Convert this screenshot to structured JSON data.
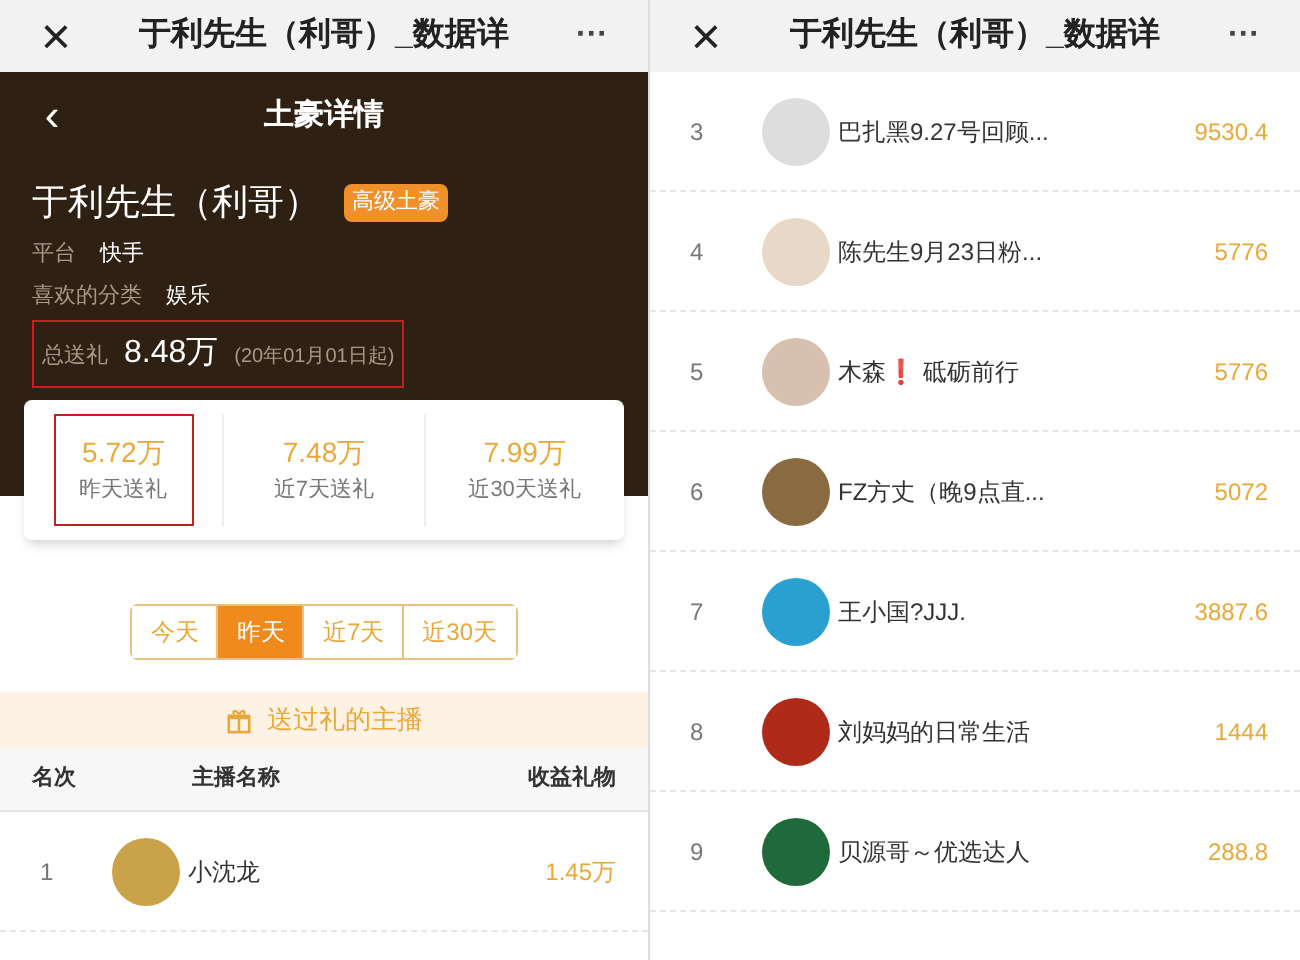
{
  "panels": [
    {
      "top_bar": {
        "close": "×",
        "title": "于利先生（利哥）_数据详",
        "more": "···"
      },
      "hero": {
        "back": "‹",
        "title": "土豪详情",
        "name": "于利先生（利哥）",
        "badge": "高级土豪",
        "fields": [
          {
            "label": "平台",
            "value": "快手"
          },
          {
            "label": "喜欢的分类",
            "value": "娱乐"
          }
        ],
        "total": {
          "label": "总送礼",
          "value": "8.48万",
          "note": "(20年01月01日起)",
          "highlighted": true
        }
      },
      "stats": [
        {
          "value": "5.72万",
          "label": "昨天送礼",
          "highlighted": true
        },
        {
          "value": "7.48万",
          "label": "近7天送礼",
          "highlighted": false
        },
        {
          "value": "7.99万",
          "label": "近30天送礼",
          "highlighted": false
        }
      ],
      "range_tabs": [
        {
          "label": "今天",
          "selected": false
        },
        {
          "label": "昨天",
          "selected": true
        },
        {
          "label": "近7天",
          "selected": false
        },
        {
          "label": "近30天",
          "selected": false
        }
      ],
      "section_title": "送过礼的主播",
      "table": {
        "columns": [
          "名次",
          "主播名称",
          "收益礼物"
        ],
        "rows": [
          {
            "rank": "1",
            "name": "小沈龙",
            "gift": "1.45万"
          }
        ]
      }
    },
    {
      "top_bar": {
        "close": "×",
        "title": "于利先生（利哥）_数据详",
        "more": "···"
      },
      "table": {
        "rows": [
          {
            "rank": "3",
            "name": "巴扎黑9.27号回顾...",
            "gift": "9530.4"
          },
          {
            "rank": "4",
            "name": "陈先生9月23日粉...",
            "gift": "5776"
          },
          {
            "rank": "5",
            "name": "木森❗ 砥砺前行",
            "gift": "5776"
          },
          {
            "rank": "6",
            "name": "FZ方丈（晚9点直...",
            "gift": "5072"
          },
          {
            "rank": "7",
            "name": "王小国?JJJ.",
            "gift": "3887.6"
          },
          {
            "rank": "8",
            "name": "刘妈妈的日常生活",
            "gift": "1444"
          },
          {
            "rank": "9",
            "name": "贝源哥～优选达人",
            "gift": "288.8"
          }
        ]
      }
    }
  ]
}
